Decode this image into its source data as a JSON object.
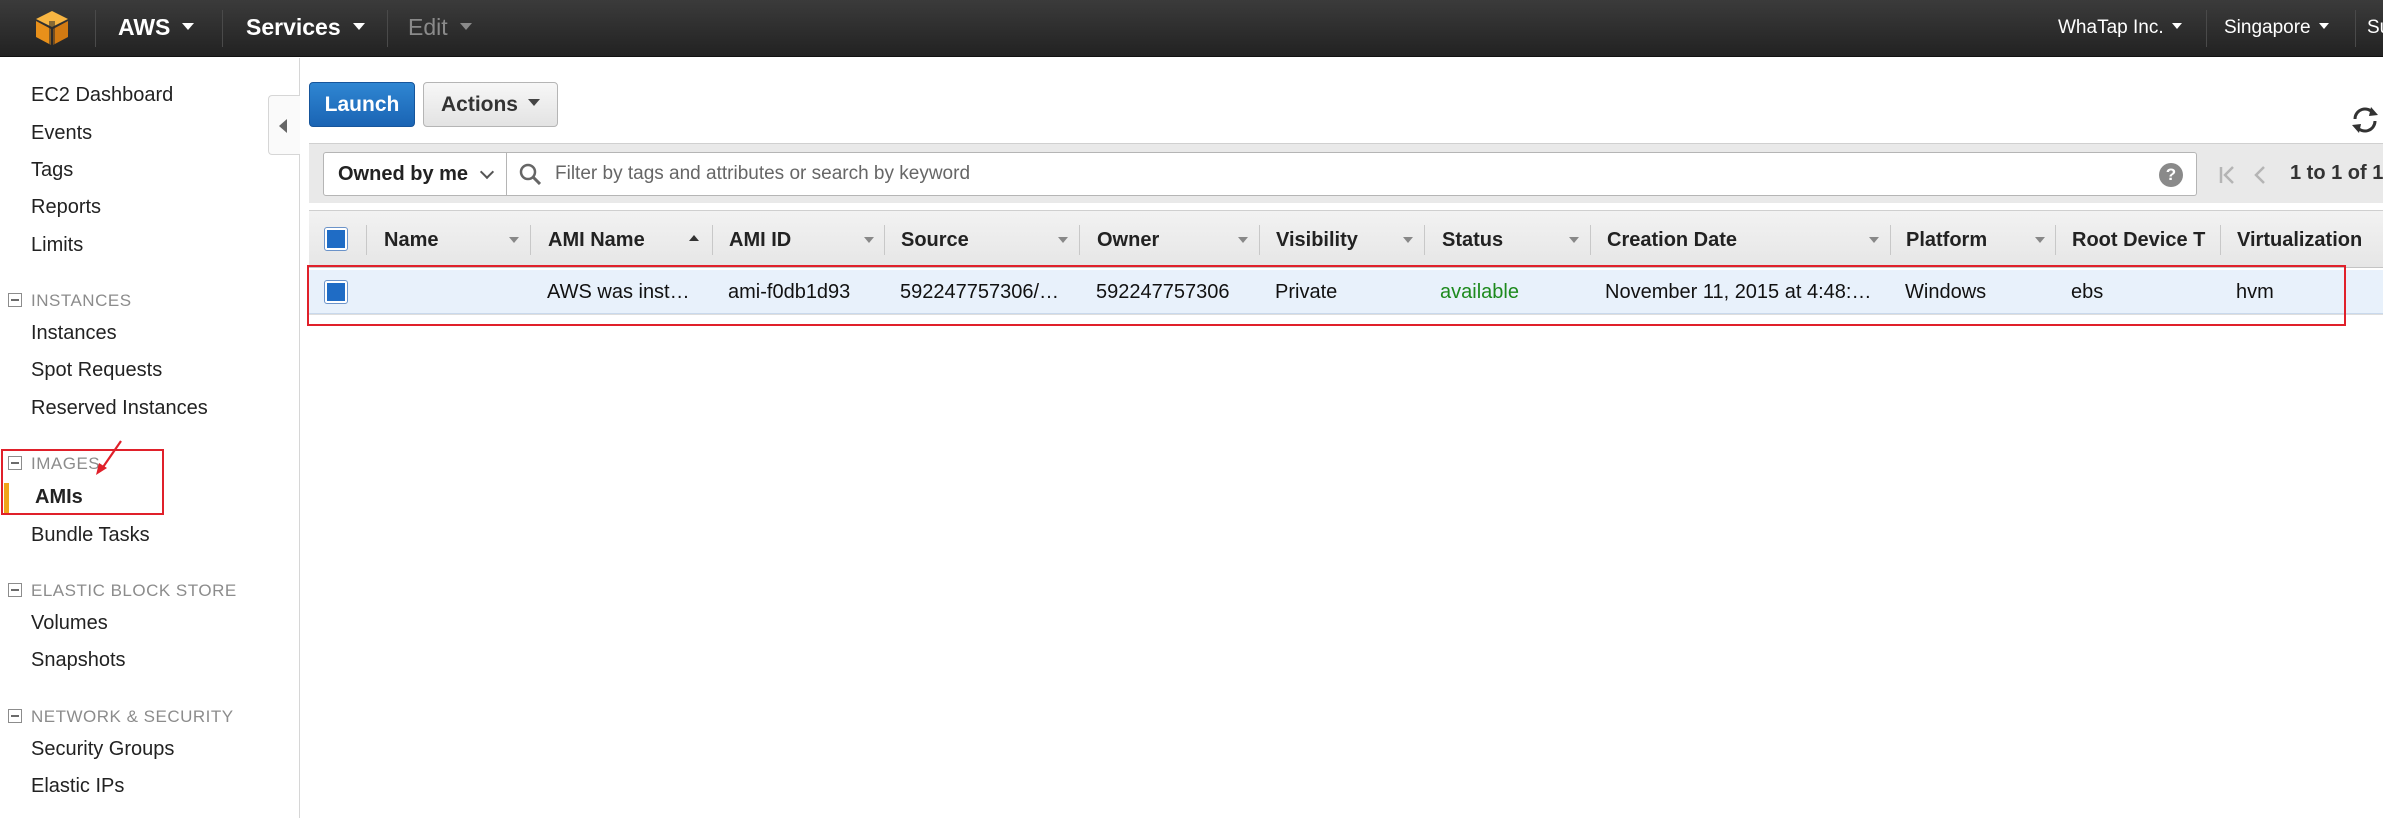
{
  "topbar": {
    "brand": "AWS",
    "services": "Services",
    "edit": "Edit",
    "account": "WhaTap Inc.",
    "region": "Singapore",
    "support": "Su"
  },
  "sidebar": {
    "top_items": [
      "EC2 Dashboard",
      "Events",
      "Tags",
      "Reports",
      "Limits"
    ],
    "sections": [
      {
        "title": "INSTANCES",
        "items": [
          "Instances",
          "Spot Requests",
          "Reserved Instances"
        ]
      },
      {
        "title": "IMAGES",
        "items": [
          "AMIs",
          "Bundle Tasks"
        ]
      },
      {
        "title": "ELASTIC BLOCK STORE",
        "items": [
          "Volumes",
          "Snapshots"
        ]
      },
      {
        "title": "NETWORK & SECURITY",
        "items": [
          "Security Groups",
          "Elastic IPs"
        ]
      }
    ],
    "active_item": "AMIs",
    "accent_color": "#f0a51a"
  },
  "toolbar": {
    "launch_label": "Launch",
    "actions_label": "Actions",
    "launch_color": "#1f6cc5"
  },
  "filter": {
    "owner_value": "Owned by me",
    "search_placeholder": "Filter by tags and attributes or search by keyword",
    "help": "?",
    "pagination": "1 to 1 of 1"
  },
  "table": {
    "columns": [
      "Name",
      "AMI Name",
      "AMI ID",
      "Source",
      "Owner",
      "Visibility",
      "Status",
      "Creation Date",
      "Platform",
      "Root Device T",
      "Virtualization"
    ],
    "sorted_column": "AMI Name",
    "rows": [
      {
        "name": "",
        "ami_name": "AWS was inst…",
        "ami_id": "ami-f0db1d93",
        "source": "592247757306/…",
        "owner": "592247757306",
        "visibility": "Private",
        "status": "available",
        "creation_date": "November 11, 2015 at 4:48:…",
        "platform": "Windows",
        "root_device": "ebs",
        "virtualization": "hvm"
      }
    ],
    "status_color": "#1d8a1d"
  },
  "annotation_color": "#e0202a"
}
